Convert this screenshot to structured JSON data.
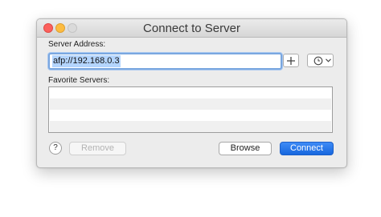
{
  "window": {
    "title": "Connect to Server"
  },
  "server_address": {
    "label": "Server Address:",
    "value": "afp://192.168.0.3"
  },
  "favorites": {
    "label": "Favorite Servers:",
    "items": []
  },
  "buttons": {
    "help": "?",
    "remove": "Remove",
    "browse": "Browse",
    "connect": "Connect"
  },
  "icons": {
    "add": "plus-icon",
    "recent": "clock-icon",
    "dropdown": "chevron-down-icon"
  },
  "colors": {
    "close": "#fc605c",
    "minimize": "#fdbc40",
    "accent": "#1a6ae0",
    "selection": "#b4d5fe"
  }
}
